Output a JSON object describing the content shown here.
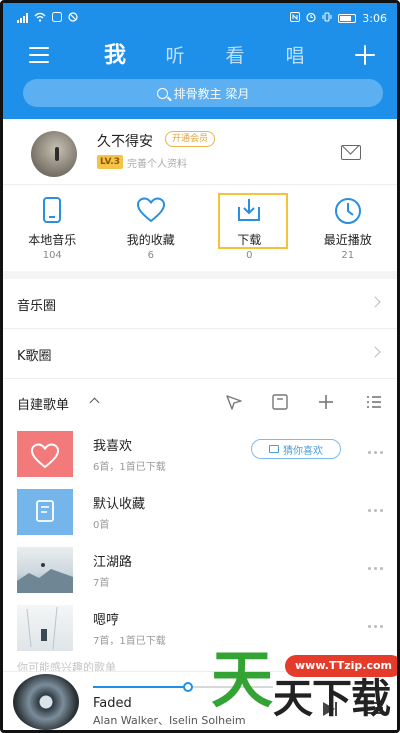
{
  "status_bar": {
    "time": "3:06"
  },
  "header": {
    "tabs": [
      {
        "label": "我",
        "active": true
      },
      {
        "label": "听",
        "active": false
      },
      {
        "label": "看",
        "active": false
      },
      {
        "label": "唱",
        "active": false
      }
    ],
    "search_placeholder": "排骨教主 梁月"
  },
  "profile": {
    "username": "久不得安",
    "vip_label": "开通会员",
    "level": "LV.3",
    "signature": "完善个人资料"
  },
  "quick_access": [
    {
      "label": "本地音乐",
      "count": "104",
      "icon": "phone-icon"
    },
    {
      "label": "我的收藏",
      "count": "6",
      "icon": "heart-icon"
    },
    {
      "label": "下载",
      "count": "0",
      "icon": "download-icon"
    },
    {
      "label": "最近播放",
      "count": "21",
      "icon": "clock-icon"
    }
  ],
  "menu_rows": [
    {
      "label": "音乐圈"
    },
    {
      "label": "K歌圈"
    }
  ],
  "playlists": {
    "title": "自建歌单",
    "items": [
      {
        "name": "我喜欢",
        "meta": "6首，1首已下载",
        "action": "猜你喜欢"
      },
      {
        "name": "默认收藏",
        "meta": "0首"
      },
      {
        "name": "江湖路",
        "meta": "7首"
      },
      {
        "name": "嗯哼",
        "meta": "7首，1首已下载"
      }
    ],
    "suggest_text": "你可能感兴趣的歌单"
  },
  "player": {
    "song_title": "Faded",
    "artist": "Alan Walker、Iselin Solheim",
    "progress": 0.53
  },
  "watermark": {
    "url": "www.TTzip.com",
    "big_char": "天",
    "text": "天下载"
  },
  "colors": {
    "brand_blue": "#1e90ea",
    "highlight": "#f3c33a",
    "like_pink": "#f27a7a",
    "fav_blue": "#74b5ec"
  }
}
